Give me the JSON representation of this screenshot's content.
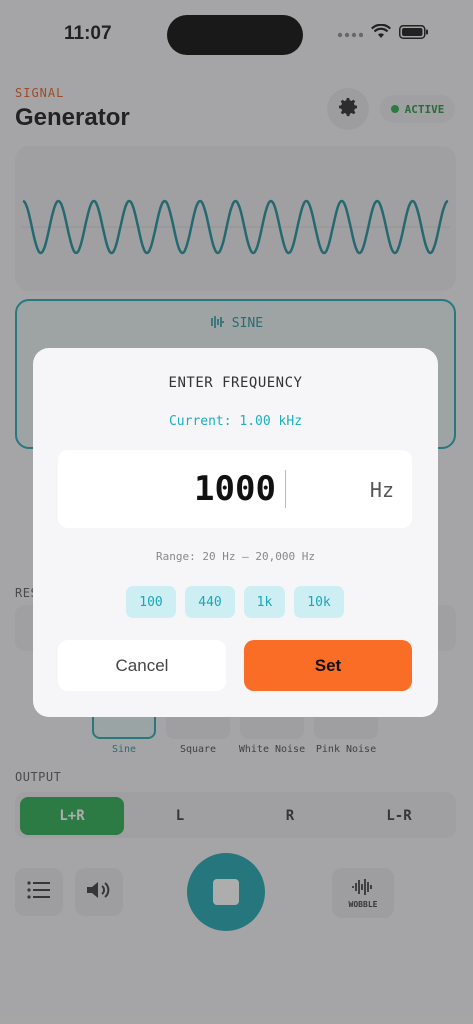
{
  "status_bar": {
    "time": "11:07"
  },
  "header": {
    "eyebrow": "SIGNAL",
    "title": "Generator",
    "active_badge": "ACTIVE"
  },
  "waveform_card": {
    "label": "SINE"
  },
  "sections": {
    "output_label": "OUTPUT",
    "partial_label": "RES"
  },
  "wave_types": [
    {
      "label": "Sine"
    },
    {
      "label": "Square"
    },
    {
      "label": "White Noise"
    },
    {
      "label": "Pink Noise"
    }
  ],
  "output": {
    "channels": [
      "L+R",
      "L",
      "R",
      "L-R"
    ],
    "selected": "L+R"
  },
  "controls": {
    "wobble_label": "WOBBLE"
  },
  "colors": {
    "accent": "#17a3ad",
    "orange": "#fa6d26",
    "green": "#22a84a",
    "signal_label": "#e0581a"
  },
  "dialog": {
    "title": "ENTER FREQUENCY",
    "current": "Current: 1.00 kHz",
    "input_value": "1000",
    "unit": "Hz",
    "range": "Range: 20 Hz — 20,000 Hz",
    "presets": [
      "100",
      "440",
      "1k",
      "10k"
    ],
    "cancel_label": "Cancel",
    "set_label": "Set"
  }
}
